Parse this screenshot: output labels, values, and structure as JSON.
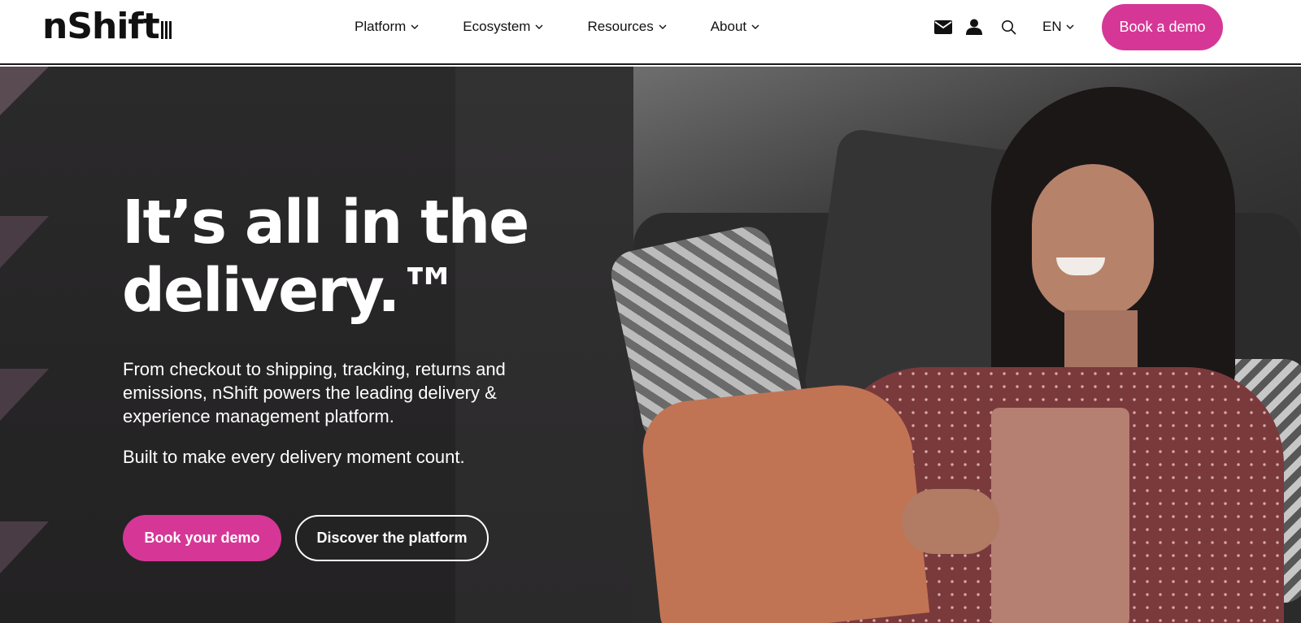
{
  "brand": {
    "name": "nShift",
    "accent": "#d63796"
  },
  "nav": {
    "items": [
      {
        "label": "Platform"
      },
      {
        "label": "Ecosystem"
      },
      {
        "label": "Resources"
      },
      {
        "label": "About"
      }
    ]
  },
  "utilities": {
    "icons": [
      "mail-icon",
      "user-icon",
      "search-icon"
    ],
    "language": "EN",
    "cta": "Book a demo"
  },
  "hero": {
    "headline_line1": "It’s all in the",
    "headline_line2": "delivery.™",
    "description": "From checkout to shipping, tracking, returns and emissions, nShift powers the leading delivery & experience management platform.",
    "tagline": "Built to make every delivery moment count.",
    "primary_cta": "Book your demo",
    "secondary_cta": "Discover the platform"
  }
}
